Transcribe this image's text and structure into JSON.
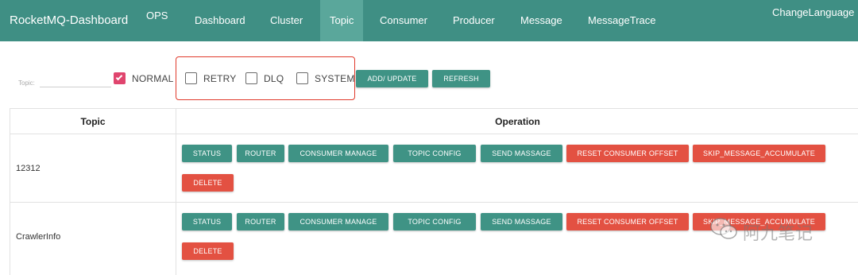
{
  "navbar": {
    "brand": "RocketMQ-Dashboard",
    "ops": "OPS",
    "items": [
      "Dashboard",
      "Cluster",
      "Topic",
      "Consumer",
      "Producer",
      "Message",
      "MessageTrace"
    ],
    "active_item": "Topic",
    "change_language": "ChangeLanguage"
  },
  "filter": {
    "topic_label": "Topic:",
    "topic_value": "",
    "checkboxes": [
      {
        "label": "NORMAL",
        "checked": true
      },
      {
        "label": "RETRY",
        "checked": false
      },
      {
        "label": "DLQ",
        "checked": false
      },
      {
        "label": "SYSTEM",
        "checked": false
      }
    ],
    "add_update_label": "ADD/ UPDATE",
    "refresh_label": "REFRESH"
  },
  "table": {
    "headers": {
      "topic": "Topic",
      "operation": "Operation"
    },
    "rows": [
      {
        "topic": "12312"
      },
      {
        "topic": "CrawlerInfo"
      }
    ],
    "buttons": {
      "status": "STATUS",
      "router": "ROUTER",
      "consumer_manage": "CONSUMER MANAGE",
      "topic_config": "TOPIC CONFIG",
      "send_massage": "SEND MASSAGE",
      "reset_consumer_offset": "RESET CONSUMER OFFSET",
      "skip_message_accumulate": "SKIP_MESSAGE_ACCUMULATE",
      "delete": "DELETE"
    }
  },
  "watermark": {
    "text": "阿九笔记"
  },
  "colors": {
    "navbar": "#3f8f84",
    "active_tab": "#5aa79b",
    "teal_button": "#3f9385",
    "red_button": "#e35142",
    "checkbox_checked": "#e0456e",
    "highlight": "#e03a2b"
  }
}
